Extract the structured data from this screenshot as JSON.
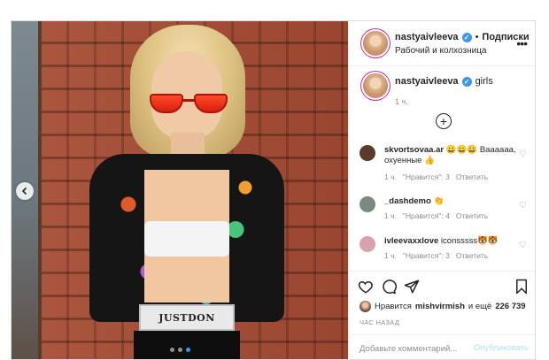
{
  "photo": {
    "belt_text": "JUSTDON",
    "carousel": {
      "count": 3,
      "active_index": 2
    }
  },
  "header": {
    "username": "nastyaivleeva",
    "separator": "•",
    "follow_label": "Подписки",
    "subtitle": "Рабочий и колхозница"
  },
  "caption": {
    "username": "nastyaivleeva",
    "text": "girls",
    "time": "1 ч."
  },
  "comments": [
    {
      "username": "skvortsovaa.ar",
      "text": "😀😀😀 Ваааааа, охуенные 👍",
      "time": "1 ч.",
      "likes": "\"Нравится\": 3",
      "reply": "Ответить",
      "avatar_color": "#5a3a2a"
    },
    {
      "username": "_dashdemo",
      "text": "👏",
      "time": "1 ч.",
      "likes": "\"Нравится\": 4",
      "reply": "Ответить",
      "avatar_color": "#7a8a7e"
    },
    {
      "username": "ivleevaxxlove",
      "text": "iconsssss🐯🐯",
      "time": "1 ч.",
      "likes": "\"Нравится\": 3",
      "reply": "Ответить",
      "avatar_color": "#d9a0b0"
    }
  ],
  "actions": {
    "likes_prefix": "Нравится",
    "likes_user": "mishvirmish",
    "likes_middle": "и ещё",
    "likes_count": "226 739",
    "time_ago": "ЧАС НАЗАД"
  },
  "comment_box": {
    "placeholder": "Добавьте комментарий...",
    "publish_label": "Опубликовать"
  },
  "colors": {
    "accent_blue": "#3897f0",
    "publish_disabled": "#b2dffc",
    "muted_text": "#8e8e8e",
    "border": "#dbdbdb"
  }
}
